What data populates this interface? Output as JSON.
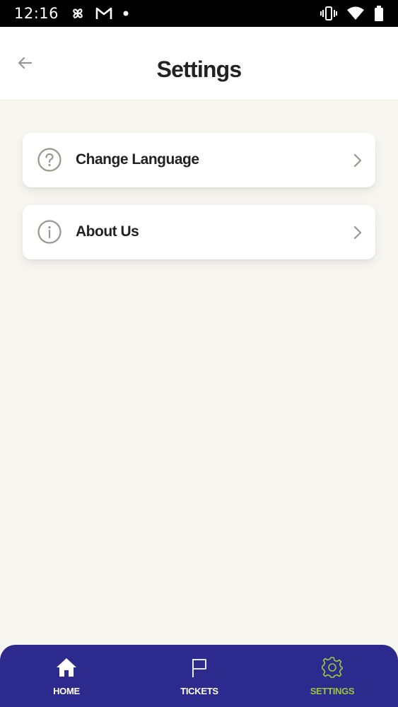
{
  "status_bar": {
    "time": "12:16",
    "icons": [
      "pinwheel-icon",
      "gmail-icon",
      "dot-icon",
      "vibrate-icon",
      "wifi-icon",
      "battery-icon"
    ]
  },
  "header": {
    "title": "Settings",
    "back_icon": "arrow-left-icon"
  },
  "settings": {
    "items": [
      {
        "label": "Change Language",
        "icon": "question-circle-icon"
      },
      {
        "label": "About Us",
        "icon": "info-circle-icon"
      }
    ]
  },
  "bottom_nav": {
    "items": [
      {
        "label": "HOME",
        "icon": "home-icon"
      },
      {
        "label": "TICKETS",
        "icon": "flag-icon"
      },
      {
        "label": "SETTINGS",
        "icon": "gear-icon",
        "active": true
      }
    ]
  },
  "colors": {
    "nav_background": "#2c2a8c",
    "nav_active": "#9bc53d",
    "nav_inactive": "#ffffff",
    "page_background": "#f7f6f0",
    "icon_muted": "#9a968d"
  }
}
